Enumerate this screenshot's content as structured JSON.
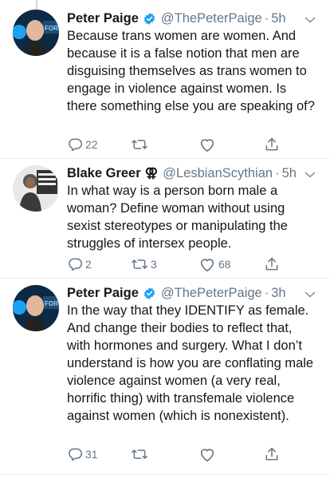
{
  "colors": {
    "accent": "#1da1f2",
    "text": "#14171a",
    "muted": "#657786",
    "divider": "#e6ecf0"
  },
  "tweets": [
    {
      "name": "Peter Paige",
      "verified": true,
      "handle": "@ThePeterPaige",
      "dot": "·",
      "time": "5h",
      "text": "Because trans women are women. And because it is a false notion that men are disguising themselves as trans women to engage in violence against women. Is there something else you are speaking of?",
      "replies": "22",
      "retweets": "",
      "likes": "",
      "avatar_icon": "person-avatar-icon"
    },
    {
      "name": "Blake Greer",
      "name_symbol": "⚢",
      "handle": "@LesbianScythian",
      "dot": "·",
      "time": "5h",
      "text": "In what way is a person born male a woman? Define woman without using sexist stereotypes or manipulating the struggles of intersex people.",
      "replies": "2",
      "retweets": "3",
      "likes": "68",
      "avatar_icon": "person-avatar-icon"
    },
    {
      "name": "Peter Paige",
      "verified": true,
      "handle": "@ThePeterPaige",
      "dot": "·",
      "time": "3h",
      "text": "In the way that they IDENTIFY as female. And change their bodies to reflect that, with hormones and surgery. What I don’t understand is how you are conflating male violence against women (a very real, horrific thing) with transfemale violence against women (which is nonexistent).",
      "replies": "31",
      "retweets": "",
      "likes": "",
      "avatar_icon": "person-avatar-icon"
    }
  ]
}
